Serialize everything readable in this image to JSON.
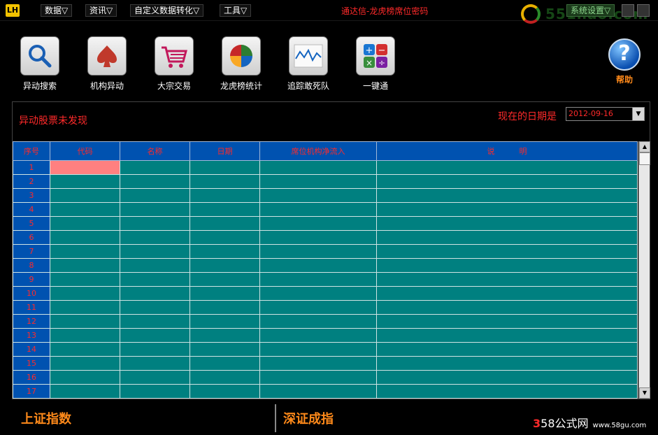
{
  "app": {
    "logo": "LH",
    "title": "通达信-龙虎榜席位密码",
    "settings_label": "系统设置▽",
    "watermark_top": "551hao.com"
  },
  "menu": [
    {
      "label": "数据▽"
    },
    {
      "label": "资讯▽"
    },
    {
      "label": "自定义数据转化▽"
    },
    {
      "label": "工具▽"
    }
  ],
  "toolbar": [
    {
      "label": "异动搜索",
      "icon": "magnifier-icon"
    },
    {
      "label": "机构异动",
      "icon": "spade-icon"
    },
    {
      "label": "大宗交易",
      "icon": "shopping-cart-icon"
    },
    {
      "label": "龙虎榜统计",
      "icon": "pie-chart-icon"
    },
    {
      "label": "追踪敢死队",
      "icon": "line-chart-icon"
    },
    {
      "label": "一键通",
      "icon": "calculator-icon"
    }
  ],
  "help": {
    "label": "帮助",
    "glyph": "?"
  },
  "panel": {
    "status_message": "异动股票未发现",
    "date_label": "现在的日期是",
    "date_value": "2012-09-16"
  },
  "table": {
    "columns": [
      "序号",
      "代码",
      "名称",
      "日期",
      "席位机构净流入",
      "说          明"
    ],
    "row_numbers": [
      "1",
      "2",
      "3",
      "4",
      "5",
      "6",
      "7",
      "8",
      "9",
      "10",
      "11",
      "12",
      "13",
      "14",
      "15",
      "16",
      "17"
    ]
  },
  "bottom": {
    "sh_index": "上证指数",
    "sz_index": "深证成指",
    "watermark_prefix": "3",
    "watermark_main": "58公式网",
    "watermark_url": "www.58gu.com"
  },
  "colors": {
    "header_bg": "#0052b0",
    "cell_bg": "#008080",
    "selected_cell": "#ff8080",
    "title_red": "#ff2a2a",
    "index_orange": "#ff8a1a"
  }
}
